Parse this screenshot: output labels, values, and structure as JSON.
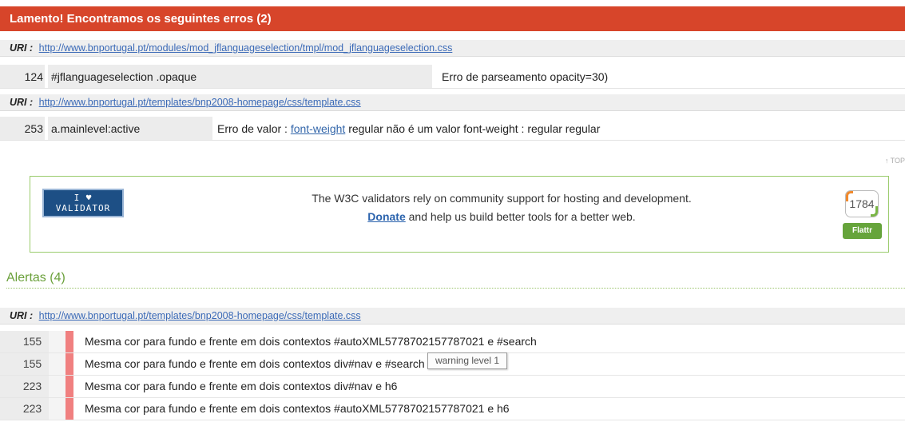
{
  "errors": {
    "header": "Lamento! Encontramos os seguintes erros (2)",
    "uri_label": "URI :",
    "groups": [
      {
        "uri": "http://www.bnportugal.pt/modules/mod_jflanguageselection/tmpl/mod_jflanguageselection.css",
        "rows": [
          {
            "line": "124",
            "context": "#jflanguageselection .opaque",
            "message": "Erro de parseamento opacity=30)"
          }
        ]
      },
      {
        "uri": "http://www.bnportugal.pt/templates/bnp2008-homepage/css/template.css",
        "rows": [
          {
            "line": "253",
            "context": "a.mainlevel:active",
            "message_prefix": "Erro de valor : ",
            "message_link": "font-weight",
            "message_suffix": " regular não é um valor font-weight : regular regular"
          }
        ]
      }
    ]
  },
  "top_link": "↑ TOP",
  "donate": {
    "badge_line1": "I ♥",
    "badge_line2": "VALIDATOR",
    "text_line1": "The W3C validators rely on community support for hosting and development.",
    "donate_link": "Donate",
    "text_line2_suffix": " and help us build better tools for a better web.",
    "flattr_count": "1784",
    "flattr_label": "Flattr"
  },
  "alerts": {
    "header": "Alertas (4)",
    "uri_label": "URI :",
    "uri": "http://www.bnportugal.pt/templates/bnp2008-homepage/css/template.css",
    "rows": [
      {
        "line": "155",
        "message": "Mesma cor para fundo e frente em dois contextos #autoXML5778702157787021 e #search"
      },
      {
        "line": "155",
        "message": "Mesma cor para fundo e frente em dois contextos div#nav e #search"
      },
      {
        "line": "223",
        "message": "Mesma cor para fundo e frente em dois contextos div#nav e h6"
      },
      {
        "line": "223",
        "message": "Mesma cor para fundo e frente em dois contextos #autoXML5778702157787021 e h6"
      }
    ],
    "tooltip": "warning level 1"
  },
  "colors": {
    "error_header": "#d7452a",
    "alerts_header": "#6aa03a",
    "warning_bar": "#f08080",
    "link": "#3b6ab7"
  }
}
